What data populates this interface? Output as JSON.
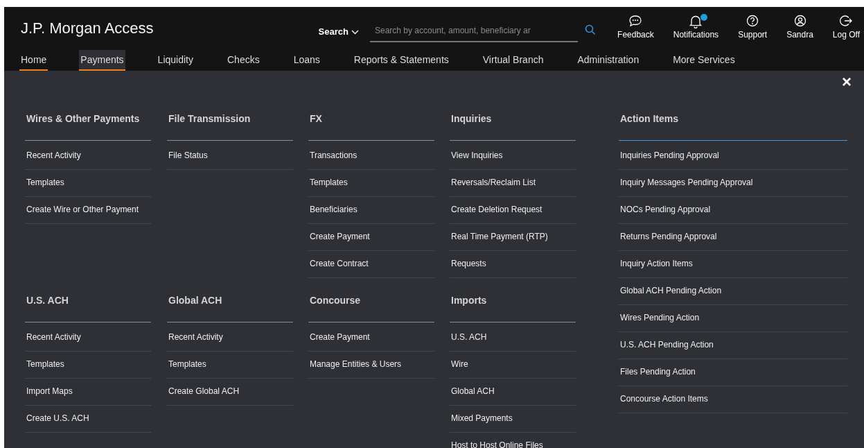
{
  "header": {
    "logo": "J.P. Morgan Access",
    "search_scope": "Search",
    "search": {
      "placeholder": "Search by account, amount, beneficiary ar"
    },
    "actions": [
      {
        "kind": "feedback",
        "label": "Feedback",
        "unread": false
      },
      {
        "kind": "notifications",
        "label": "Notifications",
        "unread": true
      },
      {
        "kind": "support",
        "label": "Support",
        "unread": false
      },
      {
        "kind": "user",
        "label": "Sandra",
        "unread": false
      },
      {
        "kind": "logoff",
        "label": "Log Off",
        "unread": false
      }
    ]
  },
  "nav": [
    {
      "label": "Home",
      "current": true,
      "selected": false
    },
    {
      "label": "Payments",
      "current": true,
      "selected": true
    },
    {
      "label": "Liquidity",
      "current": false,
      "selected": false
    },
    {
      "label": "Checks",
      "current": false,
      "selected": false
    },
    {
      "label": "Loans",
      "current": false,
      "selected": false
    },
    {
      "label": "Reports & Statements",
      "current": false,
      "selected": false
    },
    {
      "label": "Virtual Branch",
      "current": false,
      "selected": false
    },
    {
      "label": "Administration",
      "current": false,
      "selected": false
    },
    {
      "label": "More Services",
      "current": false,
      "selected": false
    }
  ],
  "menu": {
    "close": "×",
    "columns": [
      {
        "sections": [
          {
            "title": "Wires & Other Payments",
            "focused": false,
            "items": [
              "Recent Activity",
              "Templates",
              "Create Wire or Other Payment"
            ]
          },
          {
            "title": "U.S. ACH",
            "focused": false,
            "items": [
              "Recent Activity",
              "Templates",
              "Import Maps",
              "Create U.S. ACH"
            ]
          }
        ]
      },
      {
        "sections": [
          {
            "title": "File Transmission",
            "focused": false,
            "items": [
              "File Status"
            ]
          },
          {
            "title": "Global ACH",
            "focused": false,
            "items": [
              "Recent Activity",
              "Templates",
              "Create Global ACH"
            ]
          }
        ]
      },
      {
        "sections": [
          {
            "title": "FX",
            "focused": false,
            "items": [
              "Transactions",
              "Templates",
              "Beneficiaries",
              "Create Payment",
              "Create Contract"
            ]
          },
          {
            "title": "Concourse",
            "focused": false,
            "items": [
              "Create Payment",
              "Manage Entities & Users"
            ]
          }
        ]
      },
      {
        "sections": [
          {
            "title": "Inquiries",
            "focused": false,
            "items": [
              "View Inquiries",
              "Reversals/Reclaim List",
              "Create Deletion Request",
              "Real Time Payment (RTP)",
              "Requests"
            ]
          },
          {
            "title": "Imports",
            "focused": false,
            "items": [
              "U.S. ACH",
              "Wire",
              "Global ACH",
              "Mixed Payments",
              "Host to Host Online Files"
            ]
          }
        ]
      },
      {
        "sections": [
          {
            "title": "Action Items",
            "focused": true,
            "items": [
              "Inquiries Pending Approval",
              "Inquiry Messages Pending Approval",
              "NOCs Pending Approval",
              "Returns Pending Approval",
              "Inquiry Action Items",
              "Global ACH Pending Action",
              "Wires Pending Action",
              "U.S. ACH Pending Action",
              "Files Pending Action",
              "Concourse Action Items"
            ]
          }
        ]
      }
    ]
  }
}
